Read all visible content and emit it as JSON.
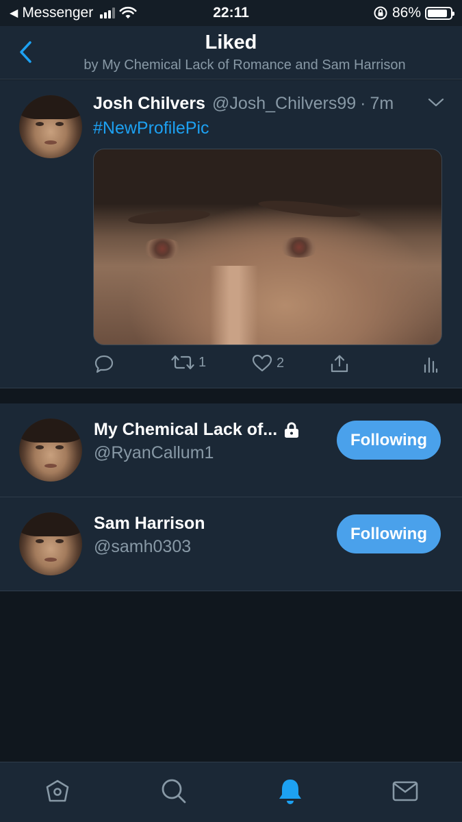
{
  "status_bar": {
    "back_app": "Messenger",
    "time": "22:11",
    "battery_percent": "86%",
    "battery_level": 0.86,
    "icons": [
      "back-triangle-icon",
      "signal-icon",
      "wifi-icon",
      "orientation-lock-icon",
      "battery-icon"
    ]
  },
  "header": {
    "title": "Liked",
    "subtitle": "by My Chemical Lack of Romance and Sam Harrison",
    "back_icon": "chevron-left-icon"
  },
  "tweet": {
    "name": "Josh Chilvers",
    "handle": "@Josh_Chilvers99",
    "separator": "·",
    "time": "7m",
    "text": "#NewProfilePic",
    "retweet_count": "1",
    "like_count": "2",
    "icons": [
      "reply-icon",
      "retweet-icon",
      "heart-icon",
      "share-icon",
      "analytics-icon",
      "chevron-down-icon"
    ]
  },
  "users": [
    {
      "name": "My Chemical Lack of...",
      "handle": "@RyanCallum1",
      "protected": true,
      "button_label": "Following"
    },
    {
      "name": "Sam Harrison",
      "handle": "@samh0303",
      "protected": false,
      "button_label": "Following"
    }
  ],
  "tab_bar": {
    "tabs": [
      "home-icon",
      "search-icon",
      "notifications-icon",
      "messages-icon"
    ],
    "active": "notifications-icon"
  },
  "colors": {
    "background": "#141d26",
    "surface": "#1b2836",
    "accent": "#1da1f2",
    "button": "#4aa1eb",
    "secondary_text": "#8899a6"
  }
}
